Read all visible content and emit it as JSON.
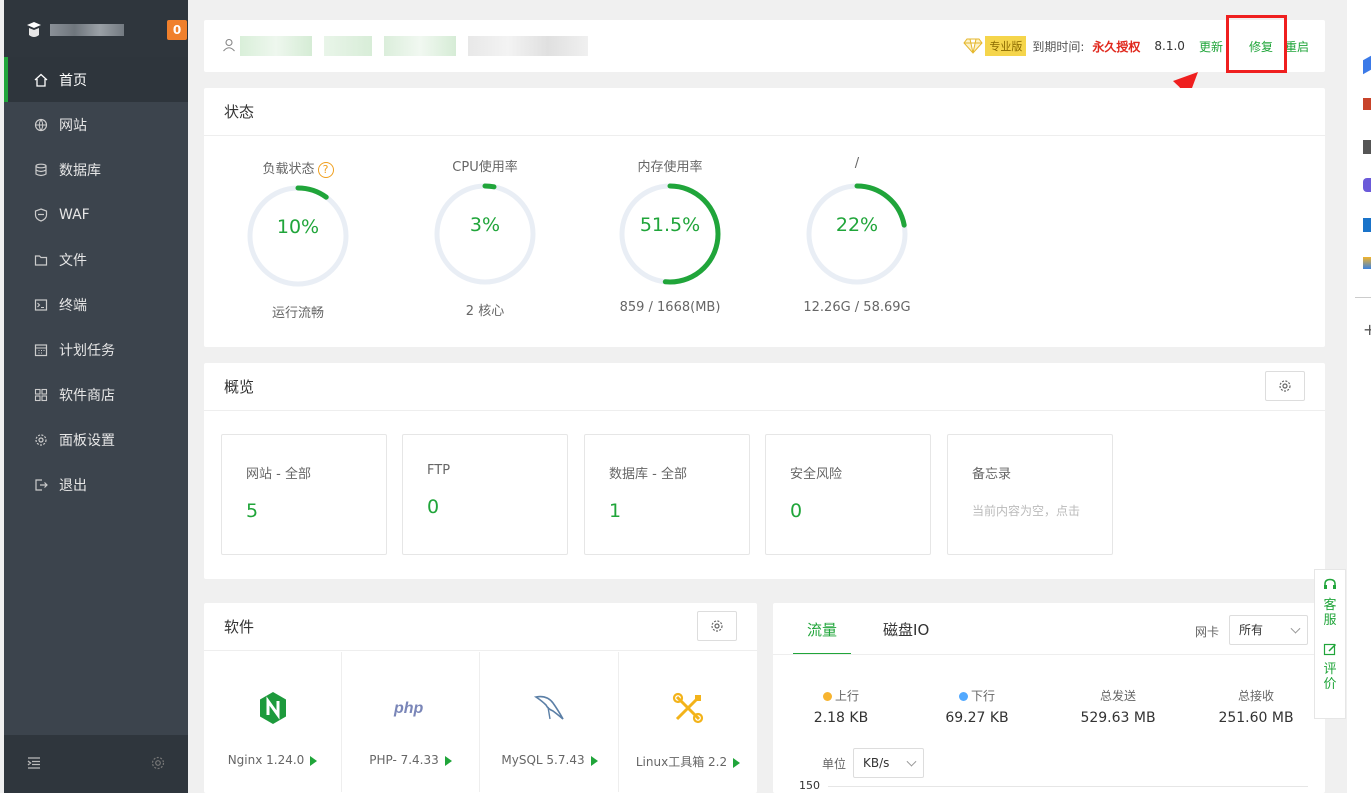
{
  "sidebar": {
    "badge": "0",
    "items": [
      {
        "label": "首页",
        "icon": "home-icon",
        "active": true
      },
      {
        "label": "网站",
        "icon": "globe-icon"
      },
      {
        "label": "数据库",
        "icon": "database-icon"
      },
      {
        "label": "WAF",
        "icon": "shield-icon"
      },
      {
        "label": "文件",
        "icon": "folder-icon"
      },
      {
        "label": "终端",
        "icon": "terminal-icon"
      },
      {
        "label": "计划任务",
        "icon": "calendar-icon"
      },
      {
        "label": "软件商店",
        "icon": "grid-icon"
      },
      {
        "label": "面板设置",
        "icon": "gear-icon"
      },
      {
        "label": "退出",
        "icon": "logout-icon"
      }
    ]
  },
  "topbar": {
    "edition": "专业版",
    "expire_label": "到期时间:",
    "expire_value": "永久授权",
    "version": "8.1.0",
    "update": "更新",
    "fix": "修复",
    "restart": "重启"
  },
  "status": {
    "title": "状态",
    "gauges": [
      {
        "title": "负载状态",
        "value": "10%",
        "sub": "运行流畅",
        "pct": 10
      },
      {
        "title": "CPU使用率",
        "value": "3%",
        "sub": "2 核心",
        "pct": 3
      },
      {
        "title": "内存使用率",
        "value": "51.5%",
        "sub": "859 / 1668(MB)",
        "pct": 51.5
      },
      {
        "title": "/",
        "value": "22%",
        "sub": "12.26G / 58.69G",
        "pct": 22
      }
    ]
  },
  "overview": {
    "title": "概览",
    "cards": [
      {
        "label": "网站 - 全部",
        "value": "5"
      },
      {
        "label": "FTP",
        "value": "0"
      },
      {
        "label": "数据库 - 全部",
        "value": "1"
      },
      {
        "label": "安全风险",
        "value": "0"
      }
    ],
    "memo_label": "备忘录",
    "memo_text": "当前内容为空，点击"
  },
  "software": {
    "title": "软件",
    "items": [
      {
        "name": "Nginx 1.24.0",
        "icon": "nginx-icon"
      },
      {
        "name": "PHP- 7.4.33",
        "icon": "php-icon"
      },
      {
        "name": "MySQL 5.7.43",
        "icon": "mysql-icon"
      },
      {
        "name": "Linux工具箱 2.2",
        "icon": "tools-icon"
      }
    ]
  },
  "traffic": {
    "tabs": [
      "流量",
      "磁盘IO"
    ],
    "nic_label": "网卡",
    "nic_value": "所有",
    "stats": [
      {
        "label": "上行",
        "value": "2.18 KB",
        "color": "#f7b430"
      },
      {
        "label": "下行",
        "value": "69.27 KB",
        "color": "#52a9ff"
      },
      {
        "label": "总发送",
        "value": "529.63 MB"
      },
      {
        "label": "总接收",
        "value": "251.60 MB"
      }
    ],
    "unit_label": "单位",
    "unit_value": "KB/s",
    "y_tick": "150"
  },
  "floating": {
    "service": "客服",
    "review": "评价"
  },
  "colors": {
    "accent": "#20a53a",
    "warning": "#e0281d"
  }
}
